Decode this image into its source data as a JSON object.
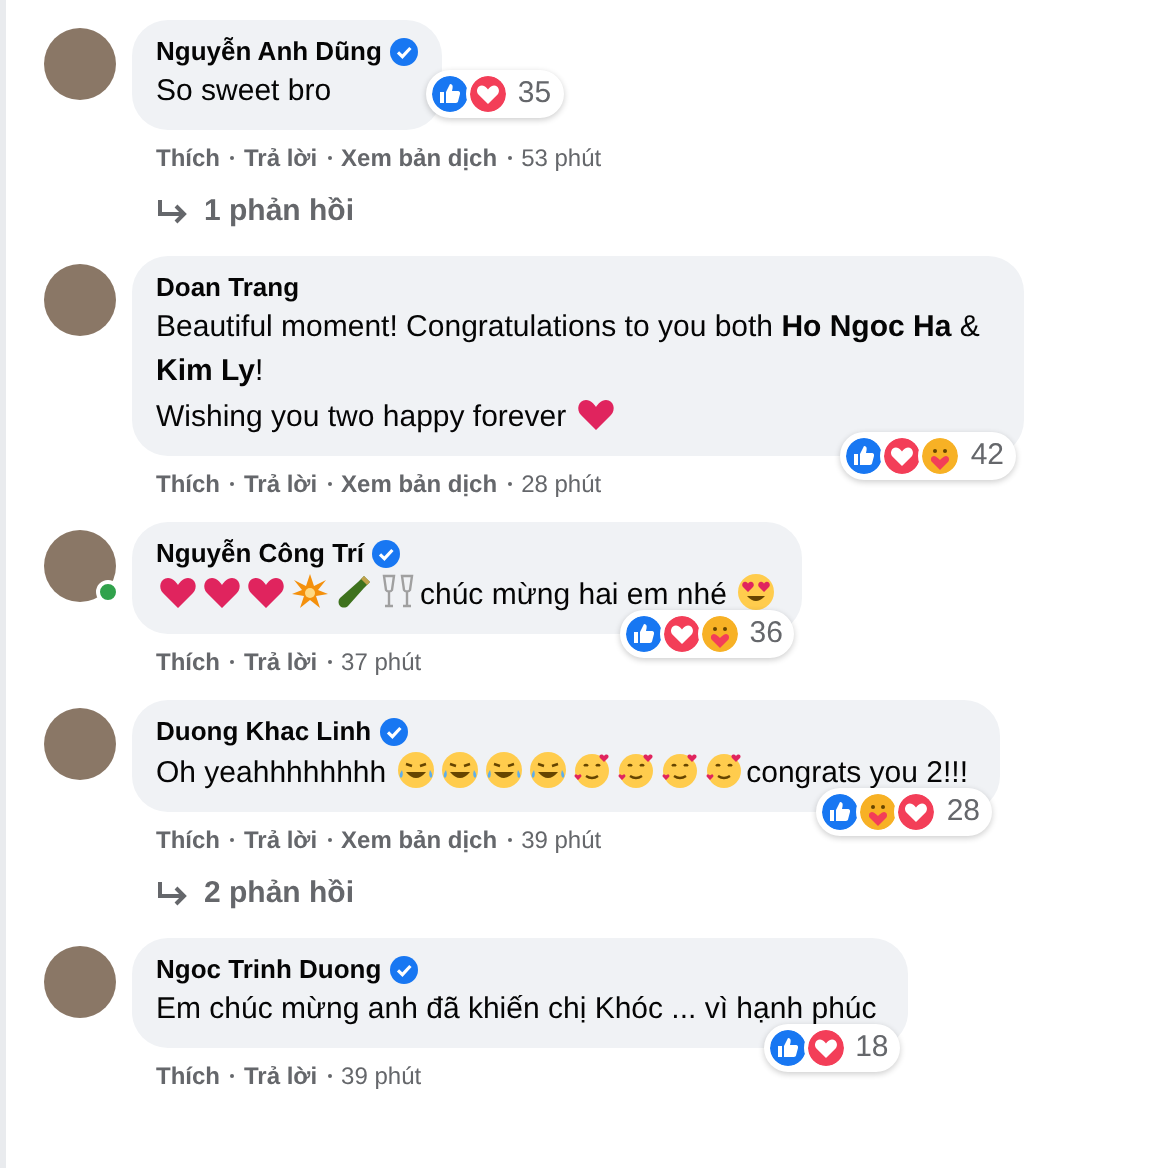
{
  "comments": [
    {
      "author": "Nguyễn Anh Dũng",
      "verified": true,
      "online": false,
      "lines": [
        [
          {
            "kind": "text",
            "text": "So sweet bro"
          }
        ]
      ],
      "reactions": [
        {
          "kind": "like"
        },
        {
          "kind": "love"
        }
      ],
      "reaction_count": "35",
      "actions": [
        "Thích",
        "Trả lời",
        "Xem bản dịch"
      ],
      "time": "53 phút",
      "replies": "1 phản hồi"
    },
    {
      "author": "Doan Trang",
      "verified": false,
      "online": false,
      "lines": [
        [
          {
            "kind": "text",
            "text": "Beautiful moment! Congratulations to you both **Ho Ngoc Ha** & **Kim Ly**!"
          }
        ],
        [
          {
            "kind": "text",
            "text": "Wishing you two happy forever"
          },
          {
            "kind": "heart"
          }
        ]
      ],
      "reactions": [
        {
          "kind": "like"
        },
        {
          "kind": "love"
        },
        {
          "kind": "care"
        }
      ],
      "reaction_count": "42",
      "actions": [
        "Thích",
        "Trả lời",
        "Xem bản dịch"
      ],
      "time": "28 phút"
    },
    {
      "author": "Nguyễn Công Trí",
      "verified": true,
      "online": true,
      "lines": [
        [
          {
            "kind": "heart"
          },
          {
            "kind": "heart"
          },
          {
            "kind": "heart"
          },
          {
            "kind": "burst"
          },
          {
            "kind": "bottle"
          },
          {
            "kind": "glasses"
          },
          {
            "kind": "text",
            "text": "chúc mừng hai em nhé"
          },
          {
            "kind": "heart-eyes"
          }
        ]
      ],
      "reactions": [
        {
          "kind": "like"
        },
        {
          "kind": "love"
        },
        {
          "kind": "care"
        }
      ],
      "reaction_count": "36",
      "actions": [
        "Thích",
        "Trả lời"
      ],
      "time": "37 phút"
    },
    {
      "author": "Duong Khac Linh",
      "verified": true,
      "online": false,
      "lines": [
        [
          {
            "kind": "text",
            "text": "Oh yeahhhhhhhh"
          },
          {
            "kind": "joy"
          },
          {
            "kind": "joy"
          },
          {
            "kind": "joy"
          },
          {
            "kind": "joy"
          },
          {
            "kind": "hearts-face"
          },
          {
            "kind": "hearts-face"
          },
          {
            "kind": "hearts-face"
          },
          {
            "kind": "hearts-face"
          },
          {
            "kind": "text",
            "text": "congrats you 2!!!"
          }
        ]
      ],
      "reactions": [
        {
          "kind": "like"
        },
        {
          "kind": "care"
        },
        {
          "kind": "love"
        }
      ],
      "reaction_count": "28",
      "actions": [
        "Thích",
        "Trả lời",
        "Xem bản dịch"
      ],
      "time": "39 phút",
      "replies": "2 phản hồi"
    },
    {
      "author": "Ngoc Trinh Duong",
      "verified": true,
      "online": false,
      "lines": [
        [
          {
            "kind": "text",
            "text": "Em chúc mừng anh đã khiến chị Khóc ... vì hạnh phúc"
          }
        ]
      ],
      "reactions": [
        {
          "kind": "like"
        },
        {
          "kind": "love"
        }
      ],
      "reaction_count": "18",
      "actions": [
        "Thích",
        "Trả lời"
      ],
      "time": "39 phút"
    }
  ]
}
